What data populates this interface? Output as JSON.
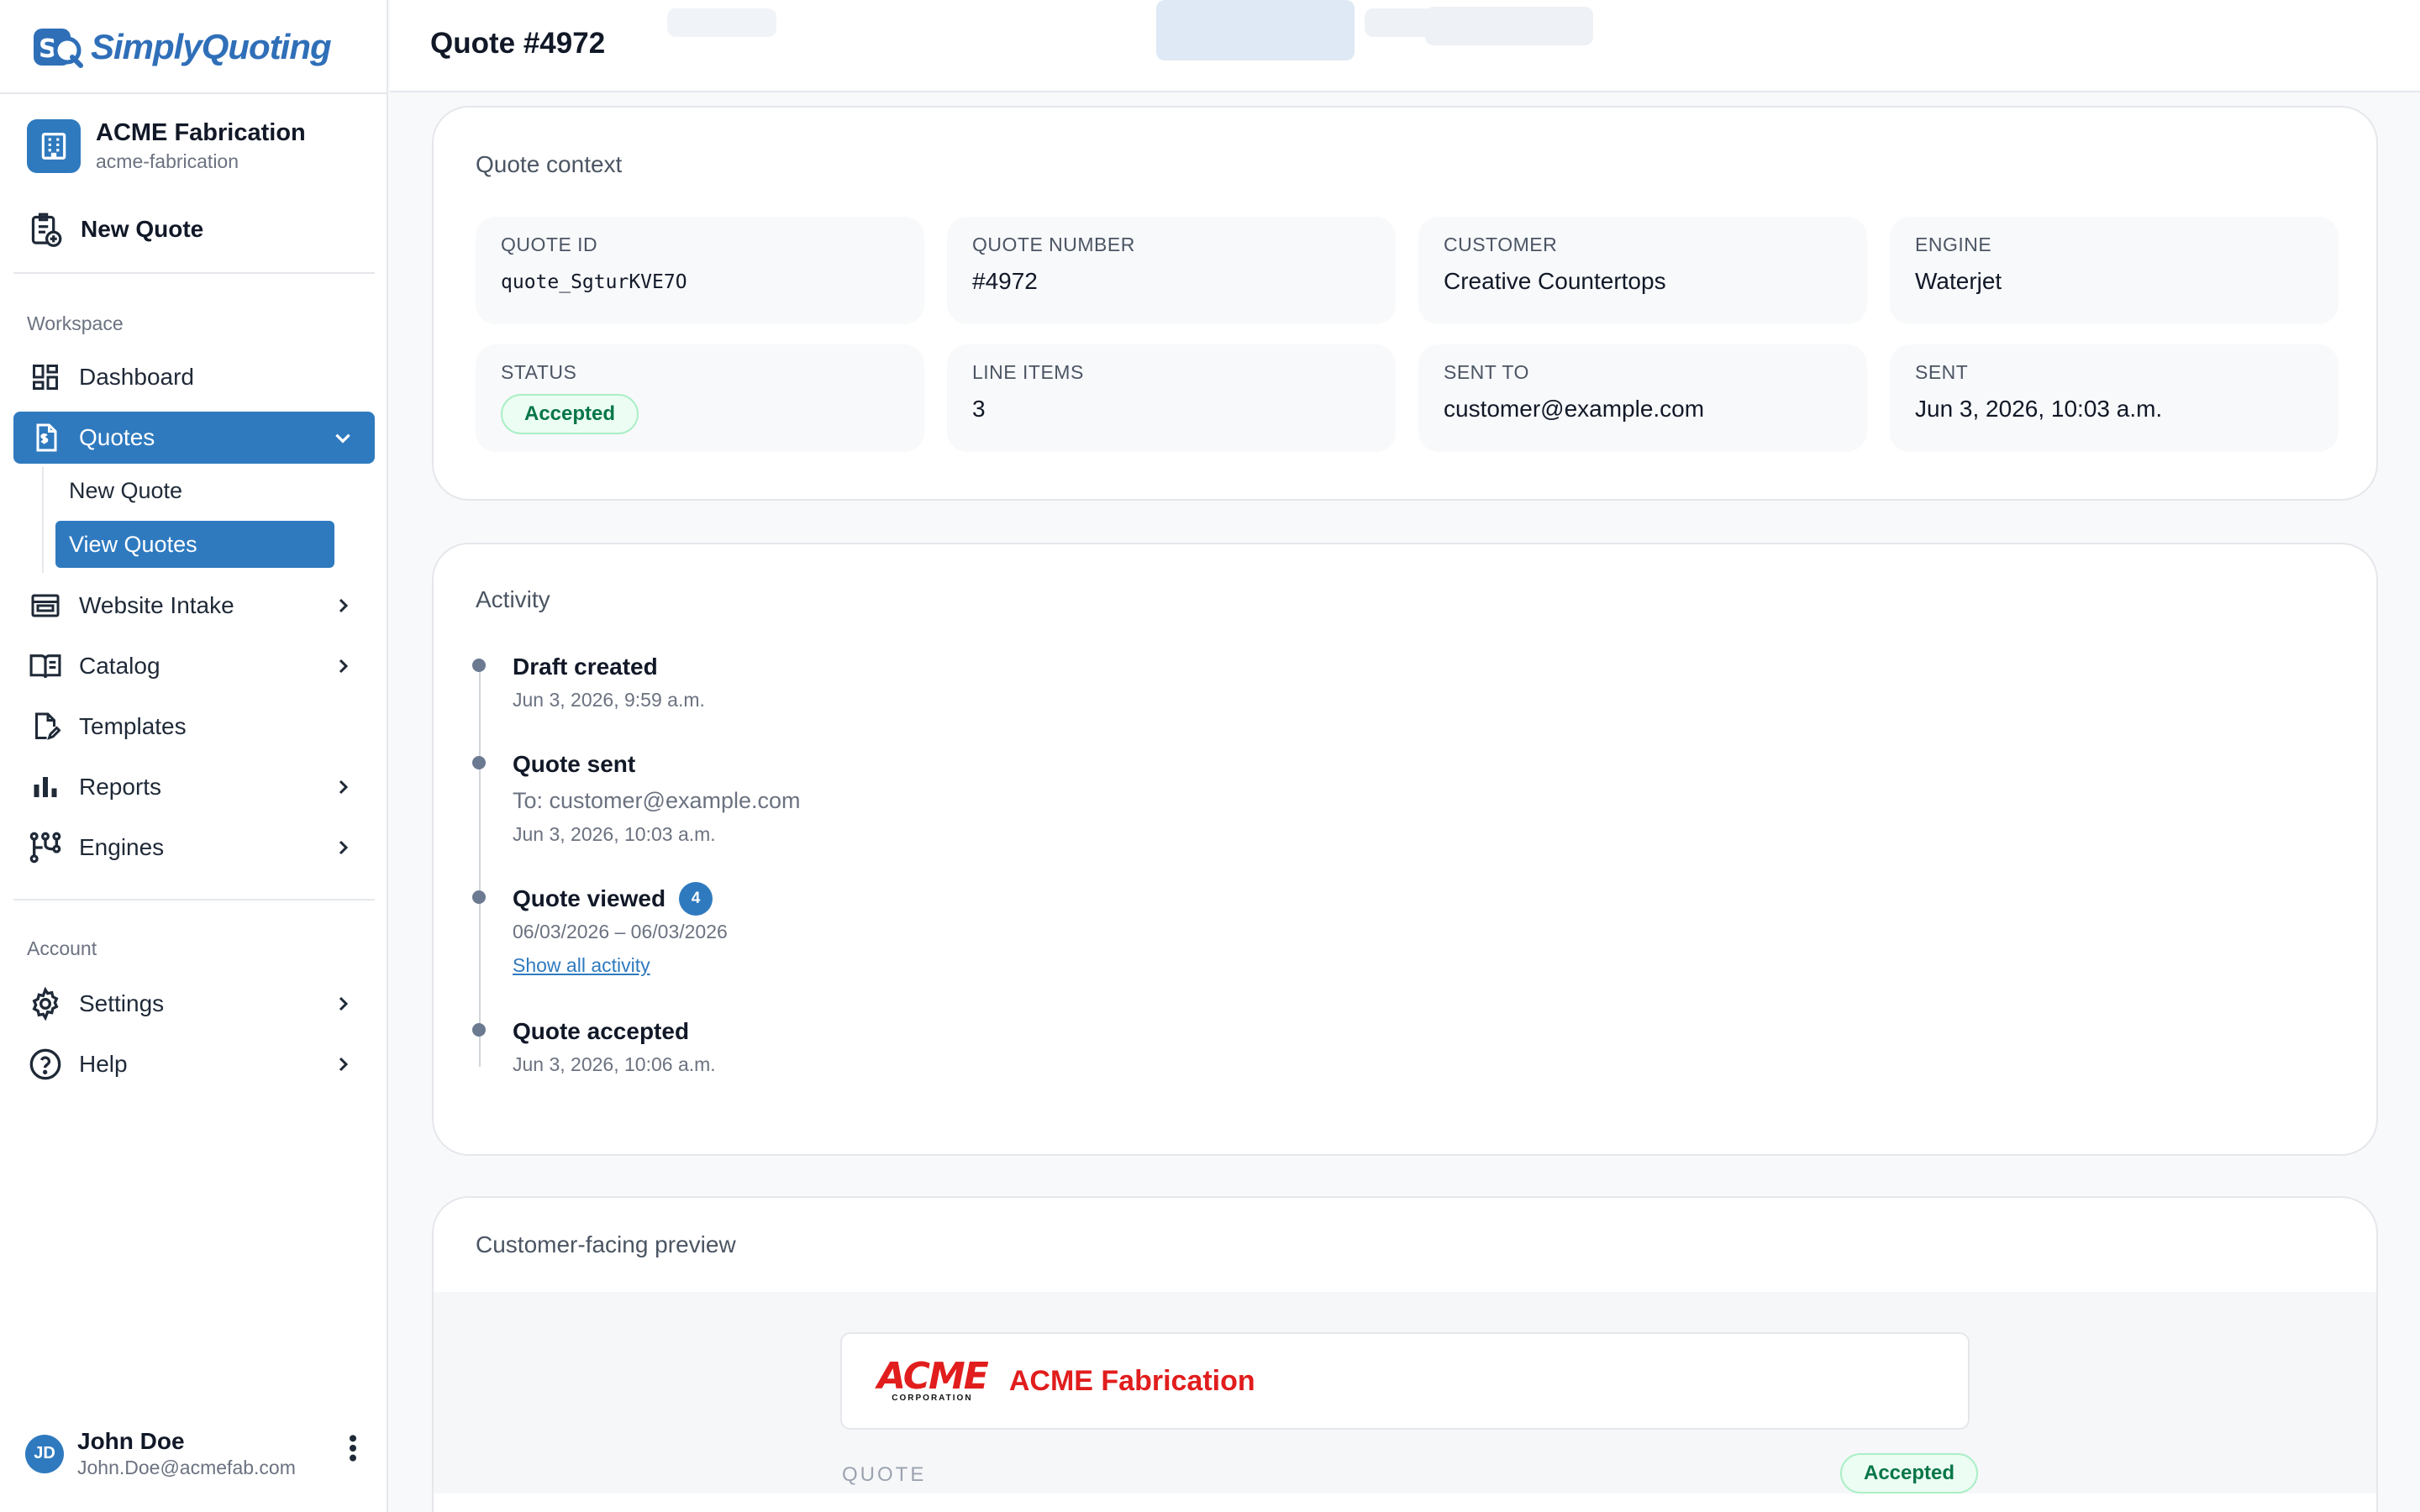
{
  "brand": {
    "name": "SimplyQuoting"
  },
  "org": {
    "name": "ACME Fabrication",
    "slug": "acme-fabrication"
  },
  "sidebar": {
    "new_quote": "New Quote",
    "workspace_label": "Workspace",
    "items": [
      {
        "label": "Dashboard"
      },
      {
        "label": "Quotes"
      },
      {
        "label": "Website Intake"
      },
      {
        "label": "Catalog"
      },
      {
        "label": "Templates"
      },
      {
        "label": "Reports"
      },
      {
        "label": "Engines"
      }
    ],
    "quotes_sub": [
      {
        "label": "New Quote"
      },
      {
        "label": "View Quotes"
      }
    ],
    "account_label": "Account",
    "account_items": [
      {
        "label": "Settings"
      },
      {
        "label": "Help"
      }
    ]
  },
  "user": {
    "initials": "JD",
    "name": "John Doe",
    "email": "John.Doe@acmefab.com"
  },
  "header": {
    "title": "Quote #4972"
  },
  "context": {
    "title": "Quote context",
    "fields": [
      {
        "label": "Quote ID",
        "value": "quote_SgturKVE7O"
      },
      {
        "label": "Quote number",
        "value": "#4972"
      },
      {
        "label": "Customer",
        "value": "Creative Countertops"
      },
      {
        "label": "Engine",
        "value": "Waterjet"
      },
      {
        "label": "Status",
        "value": "Accepted"
      },
      {
        "label": "Line items",
        "value": "3"
      },
      {
        "label": "Sent to",
        "value": "customer@example.com"
      },
      {
        "label": "Sent",
        "value": "Jun 3, 2026, 10:03 a.m."
      }
    ]
  },
  "activity": {
    "title": "Activity",
    "events": [
      {
        "title": "Draft created",
        "time": "Jun 3, 2026, 9:59 a.m."
      },
      {
        "title": "Quote sent",
        "detail": "To: customer@example.com",
        "time": "Jun 3, 2026, 10:03 a.m."
      },
      {
        "title": "Quote viewed",
        "count": "4",
        "time": "06/03/2026 – 06/03/2026",
        "link": "Show all activity"
      },
      {
        "title": "Quote accepted",
        "time": "Jun 3, 2026, 10:06 a.m."
      }
    ]
  },
  "preview": {
    "title": "Customer-facing preview",
    "logo_text": "ACME",
    "logo_sub": "CORPORATION",
    "company": "ACME Fabrication",
    "quote_label": "QUOTE",
    "status": "Accepted"
  },
  "colors": {
    "accent": "#2f7abf",
    "success_bg": "#ecfdf3",
    "success_text": "#067647",
    "brand_red": "#e11d1d"
  }
}
